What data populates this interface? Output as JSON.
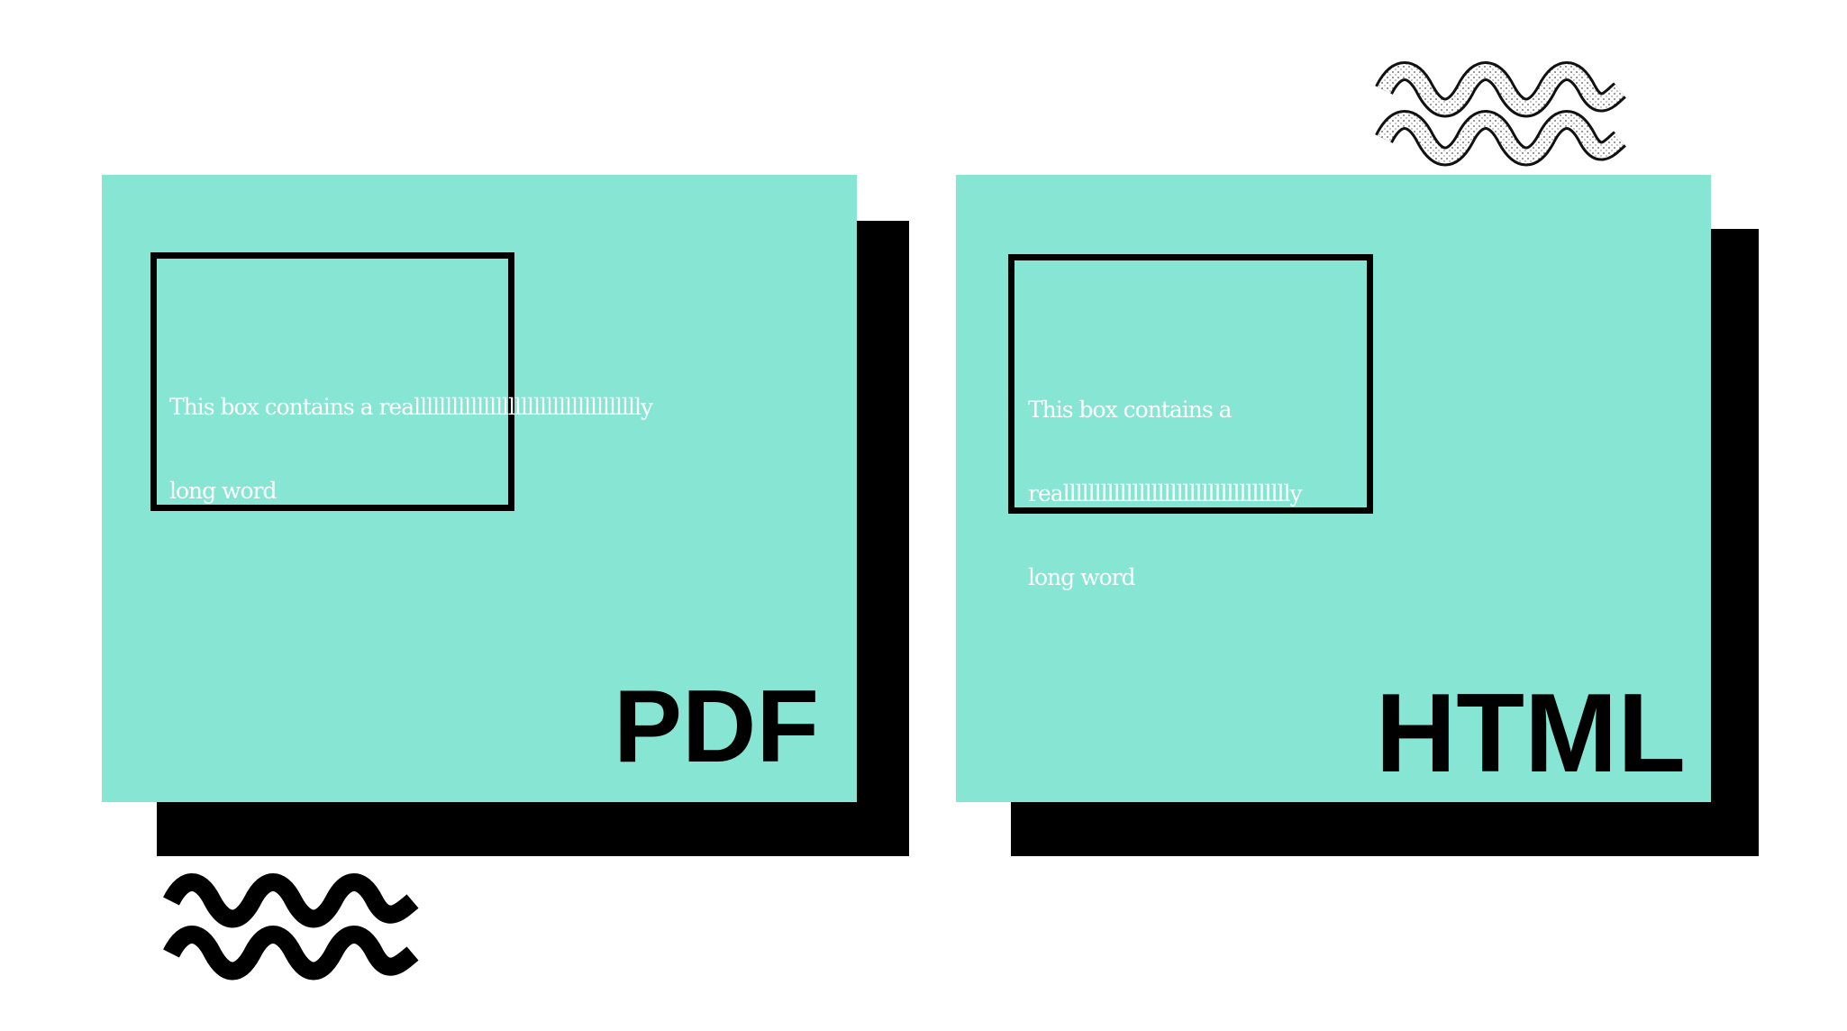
{
  "panels": {
    "pdf": {
      "label": "PDF",
      "box_text_line1": "This box contains a realllllllllllllllllllllllllllllllllllly",
      "box_text_line2": "long word"
    },
    "html": {
      "label": "HTML",
      "box_text_line1": "This box contains a",
      "box_text_line2": "realllllllllllllllllllllllllllllllllllly",
      "box_text_line3": "long word"
    }
  },
  "colors": {
    "panel_fill": "#86e5d3",
    "shadow": "#000000",
    "box_text": "#ffffff",
    "background": "#ffffff"
  },
  "decorations": {
    "top_right": "double-wave-outline-dotted-icon",
    "bottom_left": "double-wave-solid-icon"
  }
}
